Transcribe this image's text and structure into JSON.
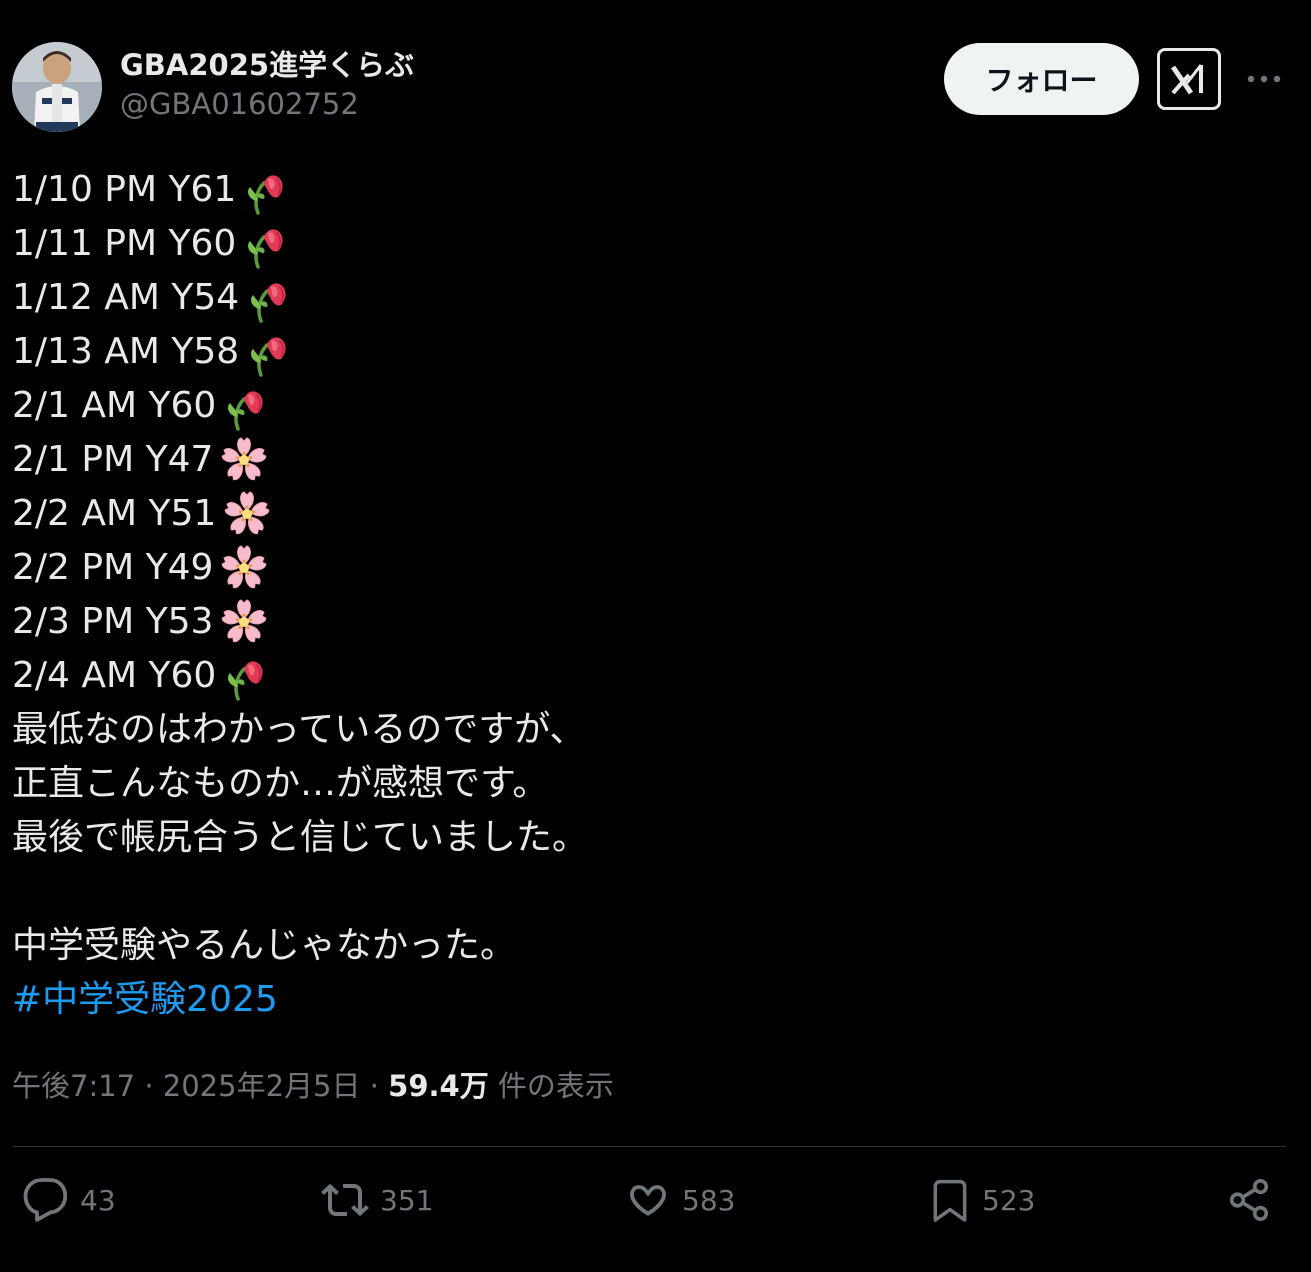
{
  "user": {
    "display_name": "GBA2025進学くらぶ",
    "handle": "@GBA01602752"
  },
  "buttons": {
    "follow_label": "フォロー"
  },
  "tweet": {
    "lines": [
      {
        "text": "1/10 PM Y61",
        "emoji": "wilted-flower-icon"
      },
      {
        "text": "1/11 PM Y60",
        "emoji": "wilted-flower-icon"
      },
      {
        "text": "1/12 AM Y54",
        "emoji": "wilted-flower-icon"
      },
      {
        "text": "1/13 AM Y58",
        "emoji": "wilted-flower-icon"
      },
      {
        "text": "2/1 AM Y60",
        "emoji": "wilted-flower-icon"
      },
      {
        "text": "2/1 PM Y47",
        "emoji": "cherry-blossom-icon"
      },
      {
        "text": "2/2 AM Y51",
        "emoji": "cherry-blossom-icon"
      },
      {
        "text": "2/2 PM Y49",
        "emoji": "cherry-blossom-icon"
      },
      {
        "text": "2/3 PM Y53",
        "emoji": "cherry-blossom-icon"
      },
      {
        "text": "2/4 AM Y60",
        "emoji": "wilted-flower-icon"
      }
    ],
    "paragraph_1": [
      "最低なのはわかっているのですが、",
      "正直こんなものか…が感想です。",
      "最後で帳尻合うと信じていました。"
    ],
    "paragraph_2": "中学受験やるんじゃなかった。",
    "hashtag": "#中学受験2025"
  },
  "meta": {
    "time": "午後7:17",
    "separator": " · ",
    "date": "2025年2月5日",
    "views_count": "59.4万",
    "views_label": " 件の表示"
  },
  "actions": {
    "replies": "43",
    "reposts": "351",
    "likes": "583",
    "bookmarks": "523"
  },
  "colors": {
    "background": "#000000",
    "text": "#e7e9ea",
    "muted": "#71767b",
    "link": "#1d9bf0",
    "follow_bg": "#eff3f4"
  }
}
